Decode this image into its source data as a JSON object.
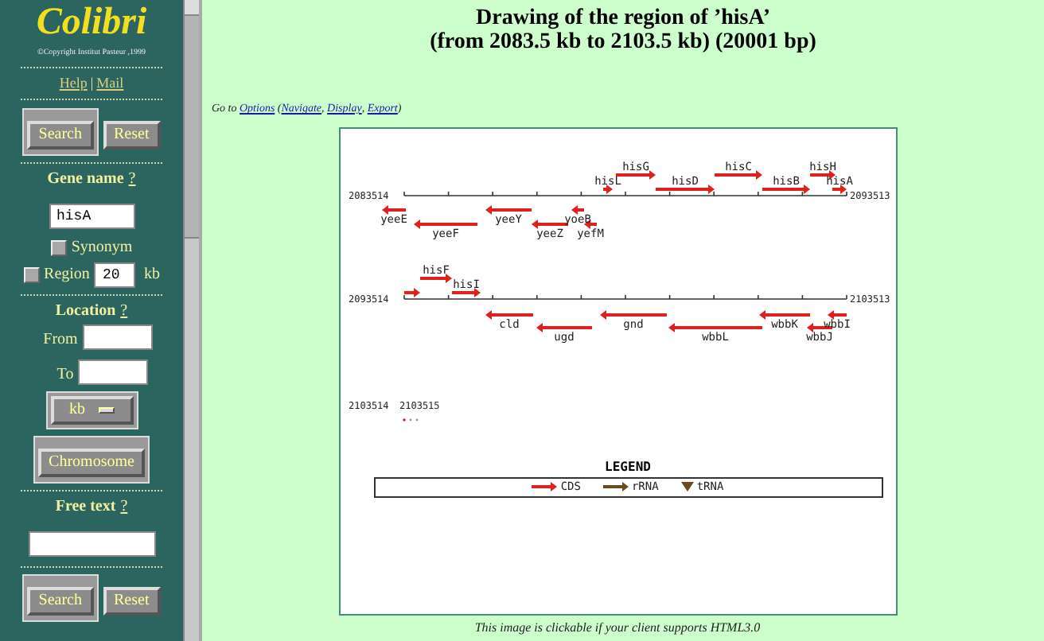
{
  "sidebar": {
    "logo": "Colibri",
    "copyright": "©Copyright Institut Pasteur ,1999",
    "links": [
      "Help",
      "Mail"
    ],
    "separator": "|",
    "top_buttons": [
      "Search",
      "Reset"
    ],
    "gene_name": {
      "label": "Gene name",
      "help": "?",
      "value": "hisA"
    },
    "synonym": {
      "label": "Synonym",
      "checked": false
    },
    "region": {
      "label": "Region",
      "checked": false,
      "value": "20",
      "unit": "kb"
    },
    "location": {
      "label": "Location",
      "help": "?",
      "from_label": "From",
      "to_label": "To",
      "unit_select": "kb",
      "button": "Chromosome"
    },
    "free_text": {
      "label": "Free text",
      "help": "?"
    },
    "bottom_buttons": [
      "Search",
      "Reset"
    ]
  },
  "main": {
    "title": "Drawing of the region of ’hisA’",
    "subtitle": "(from 2083.5 kb to 2103.5 kb) (20001 bp)",
    "goto": [
      {
        "text": "Go to ",
        "link": false
      },
      {
        "text": "Options",
        "link": true
      },
      {
        "text": " (",
        "link": false
      },
      {
        "text": "Navigate",
        "link": true
      },
      {
        "text": ", ",
        "link": false
      },
      {
        "text": "Display",
        "link": true
      },
      {
        "text": ", ",
        "link": false
      },
      {
        "text": "Export",
        "link": true
      },
      {
        "text": ")",
        "link": false
      }
    ],
    "map": {
      "rows": [
        {
          "kind": "axis",
          "start_label": "2083514",
          "end_label": "2093513",
          "genes": [
            {
              "name": "hisG",
              "kind": "forward"
            },
            {
              "name": "hisC",
              "kind": "forward"
            },
            {
              "name": "hisH",
              "kind": "forward"
            },
            {
              "name": "hisL",
              "kind": "forward"
            },
            {
              "name": "hisD",
              "kind": "forward"
            },
            {
              "name": "hisB",
              "kind": "forward"
            },
            {
              "name": "hisA",
              "kind": "forward"
            },
            {
              "name": "yeeE",
              "kind": "reverse"
            },
            {
              "name": "yeeY",
              "kind": "reverse"
            },
            {
              "name": "yoeB",
              "kind": "reverse"
            },
            {
              "name": "yeeF",
              "kind": "reverse"
            },
            {
              "name": "yeeZ",
              "kind": "reverse"
            },
            {
              "name": "yefM",
              "kind": "reverse"
            }
          ]
        },
        {
          "kind": "axis",
          "start_label": "2093514",
          "end_label": "2103513",
          "genes": [
            {
              "kind": "forward"
            },
            {
              "name": "hisF",
              "kind": "forward"
            },
            {
              "name": "hisI",
              "kind": "forward"
            },
            {
              "name": "cld",
              "kind": "reverse"
            },
            {
              "name": "gnd",
              "kind": "reverse"
            },
            {
              "name": "wbbK",
              "kind": "reverse"
            },
            {
              "name": "wbbI",
              "kind": "reverse"
            },
            {
              "name": "ugd",
              "kind": "reverse"
            },
            {
              "name": "wbbL",
              "kind": "reverse"
            },
            {
              "name": "wbbJ",
              "kind": "reverse"
            }
          ]
        },
        {
          "kind": "stub",
          "start_label": "2103514",
          "end_label": "2103515"
        }
      ],
      "legend": {
        "title": "LEGEND",
        "items": [
          {
            "label": "CDS",
            "kind": "cds"
          },
          {
            "label": "rRNA",
            "kind": "rrna"
          },
          {
            "label": "tRNA",
            "kind": "trna"
          }
        ]
      }
    },
    "caption": "This image is clickable if your client supports HTML3.0"
  }
}
